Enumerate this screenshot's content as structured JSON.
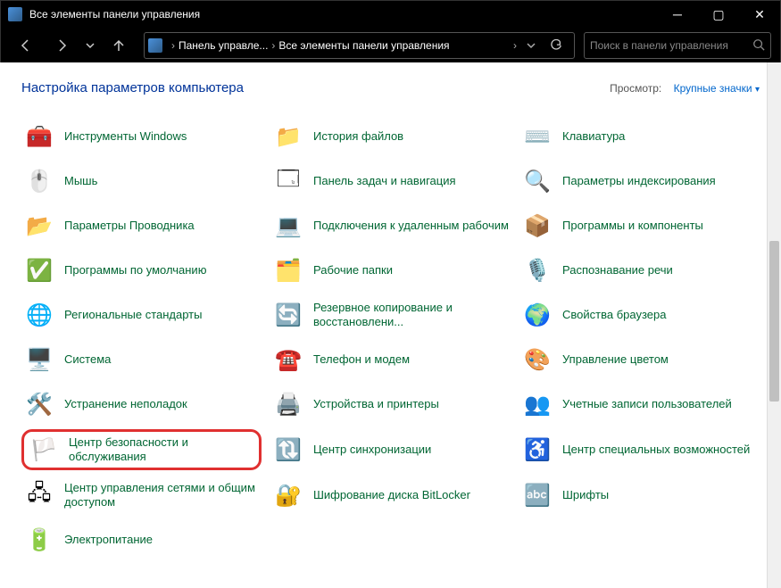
{
  "window": {
    "title": "Все элементы панели управления"
  },
  "breadcrumb": {
    "seg1": "Панель управле...",
    "seg2": "Все элементы панели управления"
  },
  "search": {
    "placeholder": "Поиск в панели управления"
  },
  "header": {
    "heading": "Настройка параметров компьютера",
    "view_label": "Просмотр:",
    "view_value": "Крупные значки"
  },
  "items": [
    {
      "label": "Инструменты Windows",
      "icon": "🧰",
      "name": "windows-tools"
    },
    {
      "label": "История файлов",
      "icon": "📁",
      "name": "file-history"
    },
    {
      "label": "Клавиатура",
      "icon": "⌨️",
      "name": "keyboard"
    },
    {
      "label": "Мышь",
      "icon": "🖱️",
      "name": "mouse"
    },
    {
      "label": "Панель задач и навигация",
      "icon": "🗔",
      "name": "taskbar-nav"
    },
    {
      "label": "Параметры индексирования",
      "icon": "🔍",
      "name": "indexing-options"
    },
    {
      "label": "Параметры Проводника",
      "icon": "📂",
      "name": "explorer-options"
    },
    {
      "label": "Подключения к удаленным рабочим",
      "icon": "💻",
      "name": "remote-desktop"
    },
    {
      "label": "Программы и компоненты",
      "icon": "📦",
      "name": "programs-features"
    },
    {
      "label": "Программы по умолчанию",
      "icon": "✅",
      "name": "default-programs"
    },
    {
      "label": "Рабочие папки",
      "icon": "🗂️",
      "name": "work-folders"
    },
    {
      "label": "Распознавание речи",
      "icon": "🎙️",
      "name": "speech-recognition"
    },
    {
      "label": "Региональные стандарты",
      "icon": "🌐",
      "name": "region"
    },
    {
      "label": "Резервное копирование и восстановлени...",
      "icon": "🔄",
      "name": "backup-restore"
    },
    {
      "label": "Свойства браузера",
      "icon": "🌍",
      "name": "internet-options"
    },
    {
      "label": "Система",
      "icon": "🖥️",
      "name": "system"
    },
    {
      "label": "Телефон и модем",
      "icon": "☎️",
      "name": "phone-modem"
    },
    {
      "label": "Управление цветом",
      "icon": "🎨",
      "name": "color-management"
    },
    {
      "label": "Устранение неполадок",
      "icon": "🛠️",
      "name": "troubleshooting"
    },
    {
      "label": "Устройства и принтеры",
      "icon": "🖨️",
      "name": "devices-printers"
    },
    {
      "label": "Учетные записи пользователей",
      "icon": "👥",
      "name": "user-accounts"
    },
    {
      "label": "Центр безопасности и обслуживания",
      "icon": "🏳️",
      "name": "security-maintenance",
      "highlighted": true
    },
    {
      "label": "Центр синхронизации",
      "icon": "🔃",
      "name": "sync-center"
    },
    {
      "label": "Центр специальных возможностей",
      "icon": "♿",
      "name": "ease-of-access"
    },
    {
      "label": "Центр управления сетями и общим доступом",
      "icon": "🖧",
      "name": "network-sharing"
    },
    {
      "label": "Шифрование диска BitLocker",
      "icon": "🔐",
      "name": "bitlocker"
    },
    {
      "label": "Шрифты",
      "icon": "🔤",
      "name": "fonts"
    },
    {
      "label": "Электропитание",
      "icon": "🔋",
      "name": "power-options"
    }
  ]
}
